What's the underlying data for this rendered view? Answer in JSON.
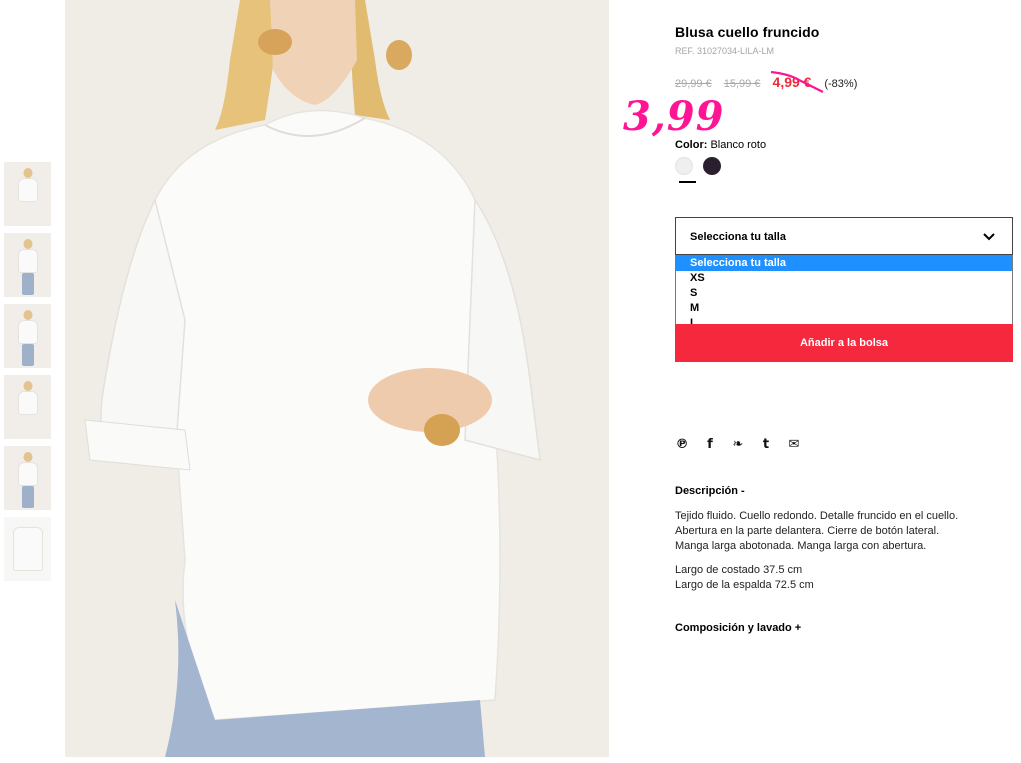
{
  "product": {
    "title": "Blusa cuello fruncido",
    "ref": "REF. 31027034-LILA-LM",
    "prices": {
      "original": "29,99 €",
      "previous": "15,99 €",
      "current": "4,99 €",
      "discount": "(-83%)",
      "handwritten_price": "3,99"
    },
    "color_label": "Color:",
    "color_value": "Blanco roto",
    "swatches": [
      {
        "name": "Blanco roto",
        "hex": "#efefef"
      },
      {
        "name": "Oscuro",
        "hex": "#2a1f2e"
      }
    ]
  },
  "size_select": {
    "label": "Selecciona tu talla",
    "options": [
      "Selecciona tu talla",
      "XS",
      "S",
      "M",
      "L"
    ],
    "highlighted": "Selecciona tu talla"
  },
  "add_to_bag": "Añadir a la bolsa",
  "social_icons": [
    "pinterest-icon",
    "facebook-icon",
    "twitter-icon",
    "tumblr-icon",
    "email-icon"
  ],
  "description": {
    "heading": "Descripción -",
    "paragraph1_line1": "Tejido fluido. Cuello redondo. Detalle fruncido en el cuello.",
    "paragraph1_line2": "Abertura en la parte delantera. Cierre de botón lateral.",
    "paragraph1_line3": "Manga larga abotonada. Manga larga con abertura.",
    "paragraph2_line1": "Largo de costado 37.5 cm",
    "paragraph2_line2": "Largo de la espalda 72.5 cm"
  },
  "composition_heading": "Composición y lavado +",
  "colors": {
    "accent_red": "#f5283e",
    "price_red": "#ee2a3a",
    "handwritten_pink": "#ff1493",
    "dropdown_highlight": "#1e90ff"
  }
}
